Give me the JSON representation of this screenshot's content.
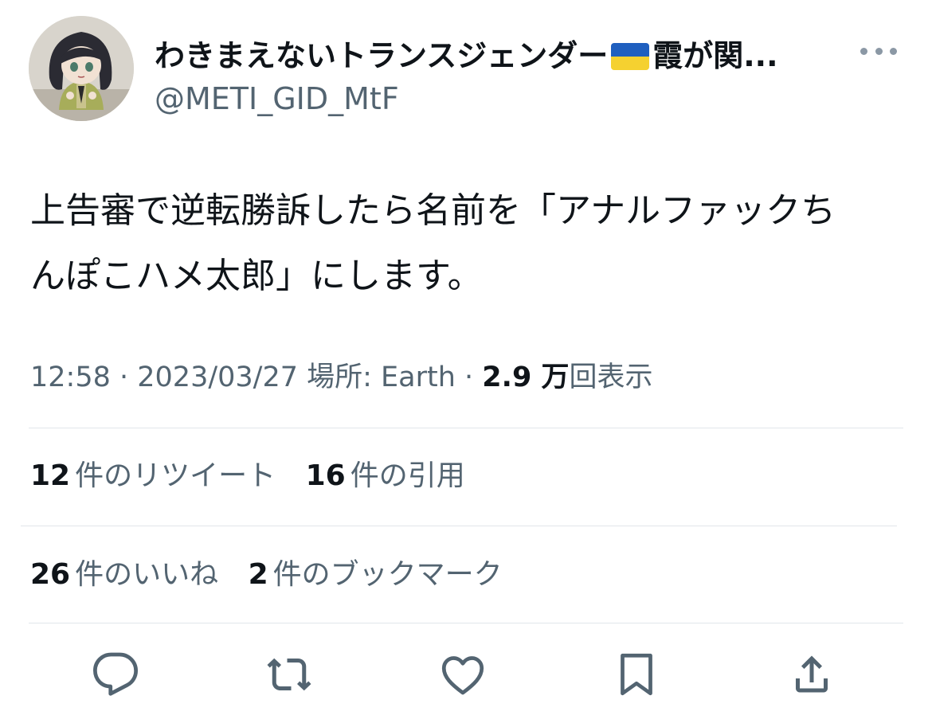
{
  "author": {
    "display_name_before_flag": "わきまえないトランスジェンダー",
    "flag_icon": "ukraine-flag-icon",
    "display_name_after_flag": "霞が関...",
    "handle": "@METI_GID_MtF",
    "avatar_icon": "figurine-avatar"
  },
  "tweet": {
    "text_line1": "上告審で逆転勝訴したら名前を「アナルファックち",
    "text_line2": "んぽこハメ太郎」にします。"
  },
  "meta": {
    "time": "12:58",
    "separator1": " · ",
    "date": "2023/03/27",
    "location_label": " 場所: ",
    "location": "Earth",
    "separator2": " · ",
    "views_count": "2.9 万",
    "views_label": "回表示"
  },
  "stats": {
    "retweets_count": "12",
    "retweets_label": "件のリツイート",
    "quotes_count": "16",
    "quotes_label": "件の引用",
    "likes_count": "26",
    "likes_label": "件のいいね",
    "bookmarks_count": "2",
    "bookmarks_label": "件のブックマーク"
  },
  "actions": [
    "reply-icon",
    "retweet-icon",
    "like-icon",
    "bookmark-icon",
    "share-icon"
  ],
  "colors": {
    "text_primary": "#0f1419",
    "text_secondary": "#536471",
    "icon_gray": "#536471",
    "divider": "#e1e6ea",
    "flag_blue": "#1f5fbf",
    "flag_yellow": "#f5d130"
  }
}
